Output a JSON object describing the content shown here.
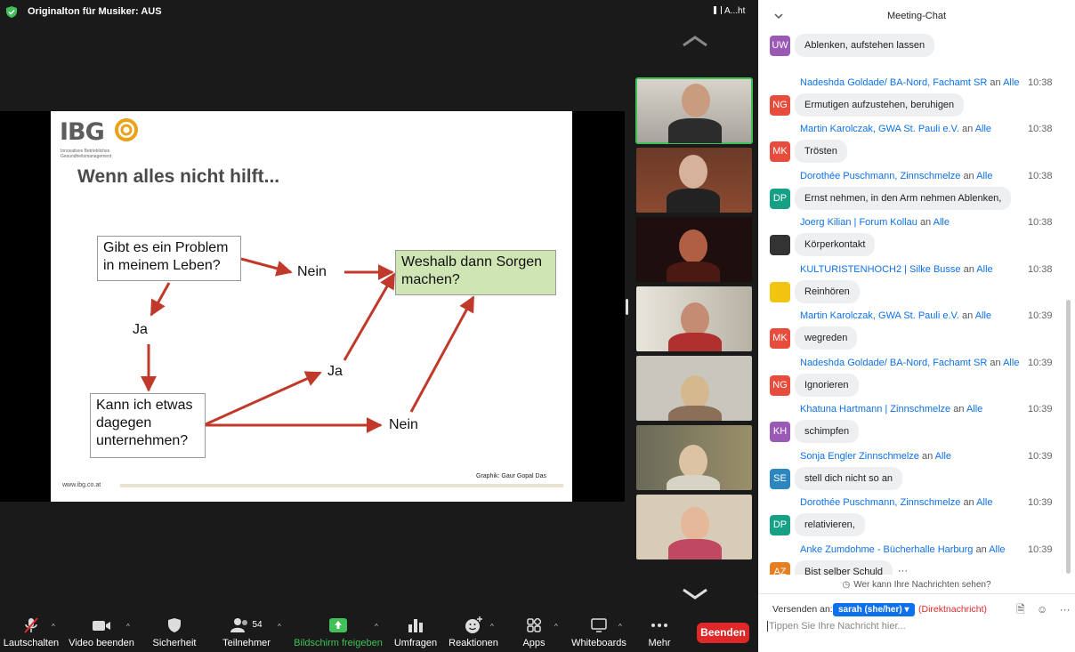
{
  "meeting": {
    "title": "Originalton für Musiker: AUS",
    "view_label": "A...ht"
  },
  "slide": {
    "logo_text": "IBG",
    "logo_sub": "Innovatives Betriebliches Gesundheitsmanagement",
    "title": "Wenn alles nicht hilft...",
    "box1": "Gibt es ein Problem in meinem Leben?",
    "nein1": "Nein",
    "box_green": "Weshalb dann Sorgen machen?",
    "ja1": "Ja",
    "ja2": "Ja",
    "box2": "Kann ich etwas dagegen unternehmen?",
    "nein2": "Nein",
    "footer_url": "www.ibg.co.at",
    "credit": "Graphik: Gaur Gopal Das"
  },
  "toolbar": {
    "mute": "Lautschalten",
    "video": "Video beenden",
    "security": "Sicherheit",
    "participants": "Teilnehmer",
    "participants_count": "54",
    "share": "Bildschirm freigeben",
    "polls": "Umfragen",
    "reactions": "Reaktionen",
    "apps": "Apps",
    "whiteboards": "Whiteboards",
    "more": "Mehr",
    "end": "Beenden"
  },
  "chat": {
    "title": "Meeting-Chat",
    "to_word": "an",
    "messages": [
      {
        "initials": "UW",
        "color": "#9b59b6",
        "name": "",
        "to": "",
        "time": "",
        "text": "Ablenken, aufstehen lassen"
      },
      {
        "initials": "NG",
        "color": "#e74c3c",
        "name": "Nadeshda Goldade/ BA-Nord, Fachamt SR",
        "to": "Alle",
        "time": "10:38",
        "text": "Ermutigen aufzustehen, beruhigen"
      },
      {
        "initials": "MK",
        "color": "#e74c3c",
        "name": "Martin Karolczak, GWA St. Pauli e.V.",
        "to": "Alle",
        "time": "10:38",
        "text": "Trösten"
      },
      {
        "initials": "DP",
        "color": "#16a085",
        "name": "Dorothée Puschmann, Zinnschmelze",
        "to": "Alle",
        "time": "10:38",
        "text": "Ernst nehmen, in den Arm nehmen Ablenken,"
      },
      {
        "initials": "",
        "color": "#333333",
        "name": "Joerg Kilian | Forum Kollau",
        "to": "Alle",
        "time": "10:38",
        "text": "Körperkontakt"
      },
      {
        "initials": "",
        "color": "#f1c40f",
        "name": "KULTURISTENHOCH2  | Silke Busse",
        "to": "Alle",
        "time": "10:38",
        "text": "Reinhören"
      },
      {
        "initials": "MK",
        "color": "#e74c3c",
        "name": "Martin Karolczak, GWA St. Pauli e.V.",
        "to": "Alle",
        "time": "10:39",
        "text": "wegreden"
      },
      {
        "initials": "NG",
        "color": "#e74c3c",
        "name": "Nadeshda Goldade/ BA-Nord, Fachamt SR",
        "to": "Alle",
        "time": "10:39",
        "text": "Ignorieren"
      },
      {
        "initials": "KH",
        "color": "#9b59b6",
        "name": "Khatuna Hartmann | Zinnschmelze",
        "to": "Alle",
        "time": "10:39",
        "text": "schimpfen"
      },
      {
        "initials": "SE",
        "color": "#2e86c1",
        "name": "Sonja Engler Zinnschmelze",
        "to": "Alle",
        "time": "10:39",
        "text": "stell dich nicht so an"
      },
      {
        "initials": "DP",
        "color": "#16a085",
        "name": "Dorothée Puschmann, Zinnschmelze",
        "to": "Alle",
        "time": "10:39",
        "text": "relativieren,"
      },
      {
        "initials": "AZ",
        "color": "#e67e22",
        "name": "Anke Zumdohme - Bücherhalle Harburg",
        "to": "Alle",
        "time": "10:39",
        "text": "Bist selber Schuld"
      }
    ],
    "who_can_see": "Wer kann Ihre Nachrichten sehen?",
    "send_to_label": "Versenden an:",
    "recipient": "sarah (she/her)",
    "direct": "(Direktnachricht)",
    "placeholder": "Tippen Sie Ihre Nachricht hier...",
    "more_dots": "···"
  }
}
